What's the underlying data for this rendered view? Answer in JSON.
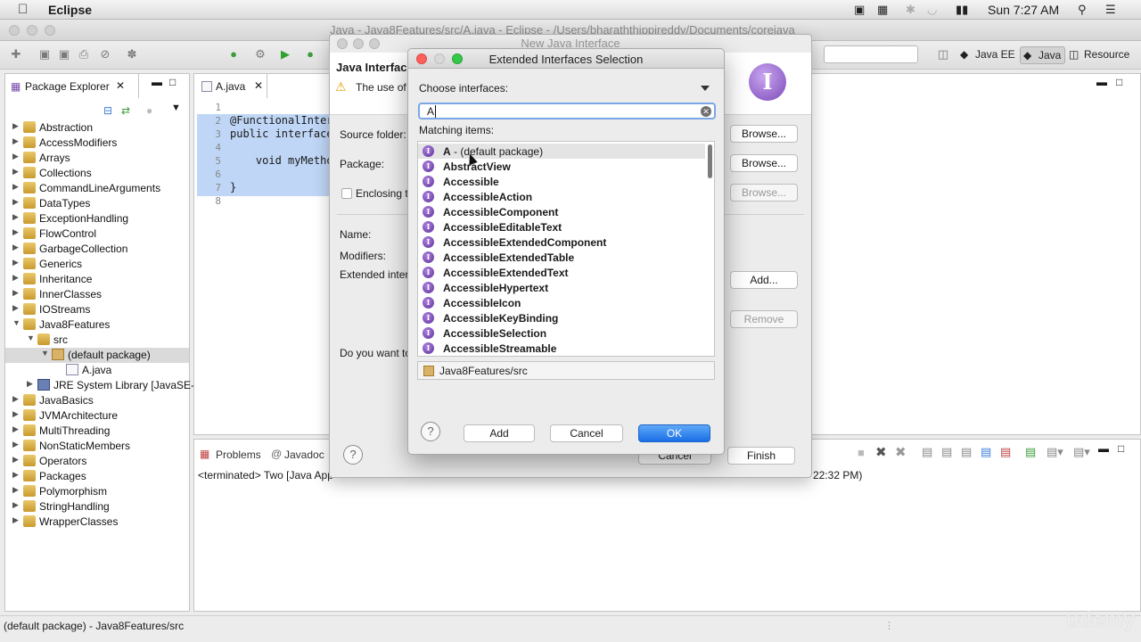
{
  "menubar": {
    "apple": "",
    "app_name": "Eclipse",
    "clock": "Sun 7:27 AM"
  },
  "window_title": "Java - Java8Features/src/A.java - Eclipse - /Users/bharaththippireddy/Documents/corejava",
  "toolbar": {
    "perspectives": [
      "Java EE",
      "Java",
      "Resource"
    ],
    "selected_perspective": "Java"
  },
  "package_explorer": {
    "tab_label": "Package Explorer",
    "items": [
      {
        "label": "Abstraction",
        "depth": 0,
        "kind": "project",
        "expanded": false
      },
      {
        "label": "AccessModifiers",
        "depth": 0,
        "kind": "project",
        "expanded": false
      },
      {
        "label": "Arrays",
        "depth": 0,
        "kind": "project",
        "expanded": false
      },
      {
        "label": "Collections",
        "depth": 0,
        "kind": "project",
        "expanded": false
      },
      {
        "label": "CommandLineArguments",
        "depth": 0,
        "kind": "project",
        "expanded": false
      },
      {
        "label": "DataTypes",
        "depth": 0,
        "kind": "project",
        "expanded": false
      },
      {
        "label": "ExceptionHandling",
        "depth": 0,
        "kind": "project",
        "expanded": false
      },
      {
        "label": "FlowControl",
        "depth": 0,
        "kind": "project",
        "expanded": false
      },
      {
        "label": "GarbageCollection",
        "depth": 0,
        "kind": "project",
        "expanded": false
      },
      {
        "label": "Generics",
        "depth": 0,
        "kind": "project",
        "expanded": false
      },
      {
        "label": "Inheritance",
        "depth": 0,
        "kind": "project",
        "expanded": false
      },
      {
        "label": "InnerClasses",
        "depth": 0,
        "kind": "project",
        "expanded": false
      },
      {
        "label": "IOStreams",
        "depth": 0,
        "kind": "project",
        "expanded": false
      },
      {
        "label": "Java8Features",
        "depth": 0,
        "kind": "project",
        "expanded": true
      },
      {
        "label": "src",
        "depth": 1,
        "kind": "srcfolder",
        "expanded": true
      },
      {
        "label": "(default package)",
        "depth": 2,
        "kind": "package",
        "expanded": true,
        "selected": true
      },
      {
        "label": "A.java",
        "depth": 3,
        "kind": "file",
        "expanded": false
      },
      {
        "label": "JRE System Library [JavaSE-",
        "depth": 1,
        "kind": "jre",
        "expanded": false
      },
      {
        "label": "JavaBasics",
        "depth": 0,
        "kind": "project",
        "expanded": false
      },
      {
        "label": "JVMArchitecture",
        "depth": 0,
        "kind": "project",
        "expanded": false
      },
      {
        "label": "MultiThreading",
        "depth": 0,
        "kind": "project",
        "expanded": false
      },
      {
        "label": "NonStaticMembers",
        "depth": 0,
        "kind": "project",
        "expanded": false
      },
      {
        "label": "Operators",
        "depth": 0,
        "kind": "project",
        "expanded": false
      },
      {
        "label": "Packages",
        "depth": 0,
        "kind": "project",
        "expanded": false
      },
      {
        "label": "Polymorphism",
        "depth": 0,
        "kind": "project",
        "expanded": false
      },
      {
        "label": "StringHandling",
        "depth": 0,
        "kind": "project",
        "expanded": false
      },
      {
        "label": "WrapperClasses",
        "depth": 0,
        "kind": "project",
        "expanded": false
      }
    ]
  },
  "editor": {
    "tab_label": "A.java",
    "line_numbers": [
      "1",
      "2",
      "3",
      "4",
      "5",
      "6",
      "7",
      "8"
    ],
    "lines": [
      "",
      "@FunctionalInter",
      "public interface",
      "",
      "    void myMetho",
      "",
      "}",
      ""
    ]
  },
  "bottom_panel": {
    "tabs": [
      "Problems",
      "Javadoc"
    ],
    "console_left": "<terminated> Two [Java App",
    "console_right": "22:32 PM)"
  },
  "status_bar": "(default package) - Java8Features/src",
  "watermark": "udemy",
  "wizard": {
    "title": "New Java Interface",
    "header": "Java Interfac",
    "message": "The use of",
    "source_folder_label": "Source folder:",
    "package_label": "Package:",
    "enclosing_label": "Enclosing t",
    "name_label": "Name:",
    "modifiers_label": "Modifiers:",
    "extended_label": "Extended inter",
    "question": "Do you want to",
    "browse_label": "Browse...",
    "add_label": "Add...",
    "remove_label": "Remove",
    "cancel_label": "Cancel",
    "finish_label": "Finish"
  },
  "selection_dialog": {
    "title": "Extended Interfaces Selection",
    "choose_label": "Choose interfaces:",
    "search_value": "A",
    "matching_label": "Matching items:",
    "items": [
      {
        "name": "A",
        "suffix": " - (default package)",
        "selected": true
      },
      {
        "name": "AbstractView",
        "suffix": ""
      },
      {
        "name": "Accessible",
        "suffix": ""
      },
      {
        "name": "AccessibleAction",
        "suffix": ""
      },
      {
        "name": "AccessibleComponent",
        "suffix": ""
      },
      {
        "name": "AccessibleEditableText",
        "suffix": ""
      },
      {
        "name": "AccessibleExtendedComponent",
        "suffix": ""
      },
      {
        "name": "AccessibleExtendedTable",
        "suffix": ""
      },
      {
        "name": "AccessibleExtendedText",
        "suffix": ""
      },
      {
        "name": "AccessibleHypertext",
        "suffix": ""
      },
      {
        "name": "AccessibleIcon",
        "suffix": ""
      },
      {
        "name": "AccessibleKeyBinding",
        "suffix": ""
      },
      {
        "name": "AccessibleSelection",
        "suffix": ""
      },
      {
        "name": "AccessibleStreamable",
        "suffix": ""
      }
    ],
    "location": "Java8Features/src",
    "add_button": "Add",
    "cancel_button": "Cancel",
    "ok_button": "OK"
  },
  "colors": {
    "selection_blue": "#bfd6f6",
    "ok_blue": "#1a6fe6",
    "interface_purple": "#7b49b8"
  }
}
